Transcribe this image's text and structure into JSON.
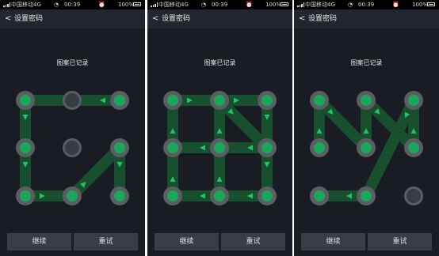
{
  "screens": [
    {
      "status": {
        "carrier": "中国移动4G",
        "time": "00:39",
        "battery": "100%"
      },
      "title": "设置密码",
      "message": "图案已记录",
      "buttons": {
        "continue": "继续",
        "retry": "重试"
      },
      "pattern": [
        3,
        1,
        4,
        7,
        8,
        6,
        9
      ]
    },
    {
      "status": {
        "carrier": "中国移动4G",
        "time": "00:39",
        "battery": "100%"
      },
      "title": "设置密码",
      "message": "图案已记录",
      "buttons": {
        "continue": "继续",
        "retry": "重试"
      },
      "pattern": [
        8,
        7,
        4,
        1,
        2,
        3,
        6,
        9,
        8,
        5,
        2,
        6,
        5,
        4
      ]
    },
    {
      "status": {
        "carrier": "中国移动4G",
        "time": "00:39",
        "battery": "100%"
      },
      "title": "设置密码",
      "message": "图案已记录",
      "buttons": {
        "continue": "继续",
        "retry": "重试"
      },
      "pattern": [
        4,
        1,
        5,
        2,
        6,
        3,
        8,
        7
      ]
    }
  ],
  "colors": {
    "line": "#184f2e",
    "dot": "#19a85a",
    "ring": "#5b5d62",
    "arrow": "#22c46a",
    "background": "#1a1c23"
  }
}
